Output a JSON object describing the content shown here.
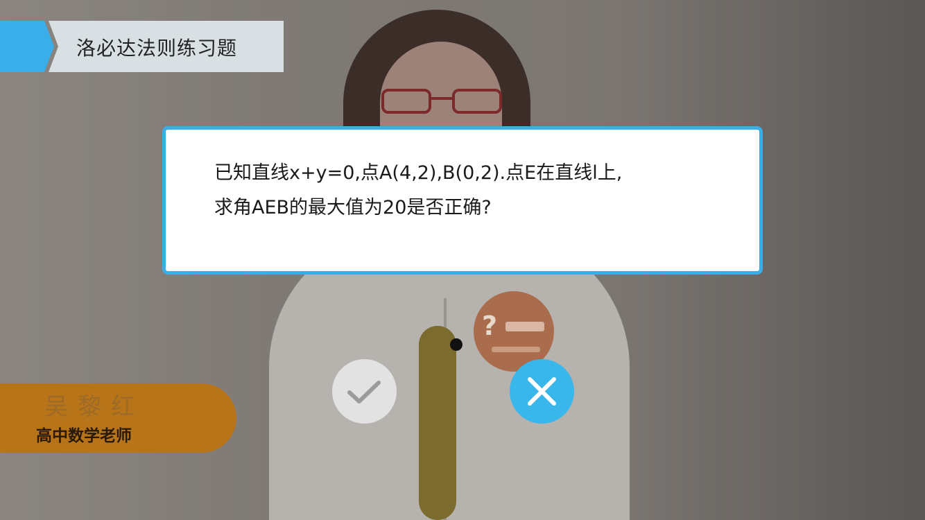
{
  "header": {
    "title": "洛必达法则练习题"
  },
  "question": {
    "lines": [
      "已知直线x+y=0,点A(4,2),B(0,2).点E在直线l上,",
      "求角AEB的最大值为20是否正确?"
    ]
  },
  "answers": {
    "true_icon": "checkmark-icon",
    "false_icon": "close-icon"
  },
  "teacher": {
    "name": "吴黎红",
    "role": "高中数学老师"
  },
  "colors": {
    "accent": "#3aaee8",
    "false_button": "#3ab7ea",
    "true_button": "#e2e2e2",
    "teacher_plate": "#b77419"
  }
}
